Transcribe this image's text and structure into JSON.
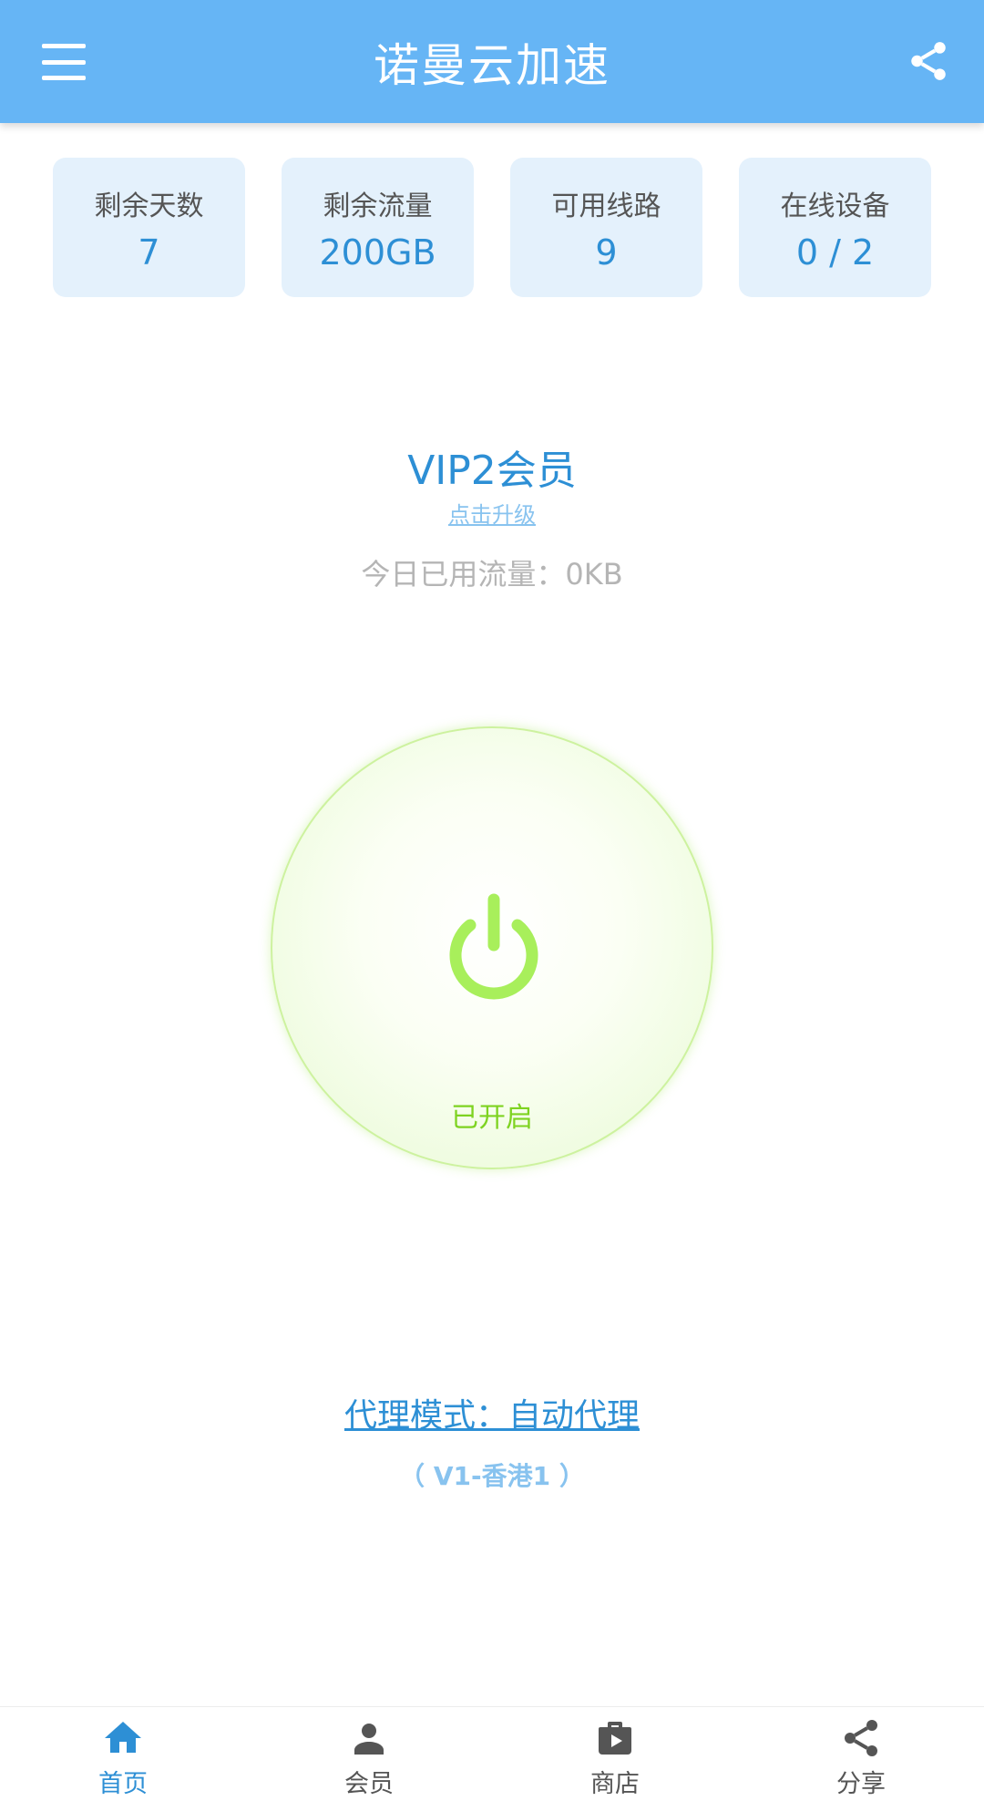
{
  "header": {
    "title": "诺曼云加速",
    "menu_icon": "menu-icon",
    "share_icon": "share-icon"
  },
  "stats": [
    {
      "label": "剩余天数",
      "value": "7"
    },
    {
      "label": "剩余流量",
      "value": "200GB"
    },
    {
      "label": "可用线路",
      "value": "9"
    },
    {
      "label": "在线设备",
      "value": "0 / 2"
    }
  ],
  "membership": {
    "level": "VIP2会员",
    "upgrade_link": "点击升级",
    "today_usage": "今日已用流量：0KB"
  },
  "power": {
    "icon": "power-icon",
    "status": "已开启",
    "color": "#a8ef5b"
  },
  "proxy": {
    "mode_link": "代理模式：自动代理",
    "line": "（ V1-香港1 ）"
  },
  "bottom_nav": [
    {
      "label": "首页",
      "icon": "home-icon",
      "active": true
    },
    {
      "label": "会员",
      "icon": "person-icon",
      "active": false
    },
    {
      "label": "商店",
      "icon": "shop-icon",
      "active": false
    },
    {
      "label": "分享",
      "icon": "share-icon",
      "active": false
    }
  ],
  "colors": {
    "header": "#66b5f5",
    "accent": "#2d8fd5",
    "card_bg": "#e4f1fc",
    "power_green": "#a8ef5b",
    "status_green": "#7ed321"
  }
}
